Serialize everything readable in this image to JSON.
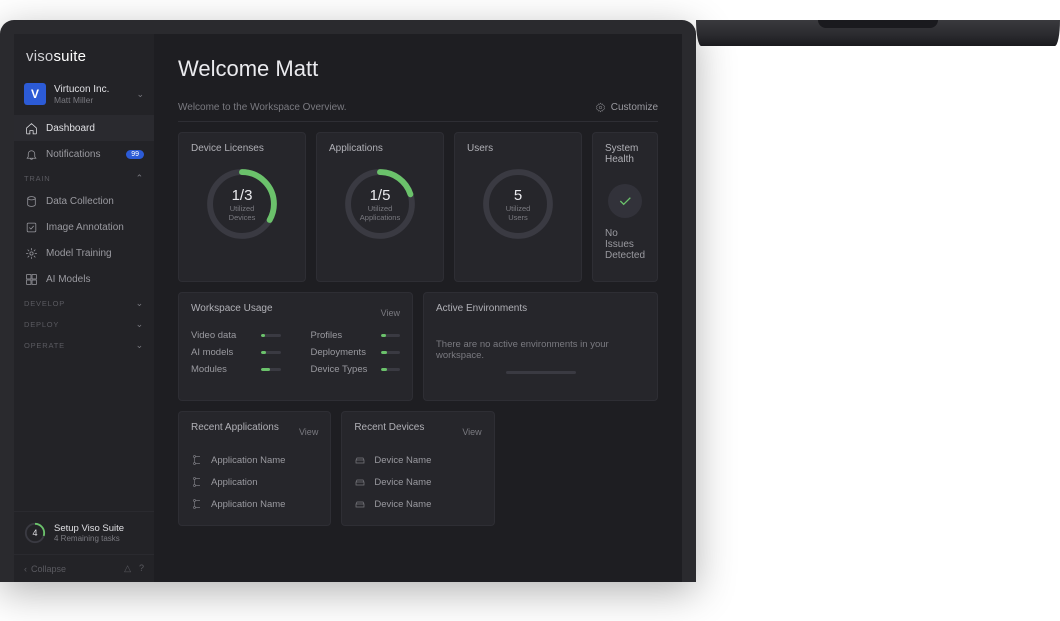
{
  "brand": {
    "prefix": "viso",
    "suffix": "suite"
  },
  "org": {
    "badge": "V",
    "name": "Virtucon Inc.",
    "user": "Matt Miller"
  },
  "nav": {
    "dashboard": "Dashboard",
    "notifications": "Notifications",
    "notifications_badge": "99",
    "train": {
      "label": "TRAIN",
      "items": [
        "Data Collection",
        "Image Annotation",
        "Model Training",
        "AI Models"
      ]
    },
    "develop": "DEVELOP",
    "deploy": "DEPLOY",
    "operate": "OPERATE"
  },
  "setup": {
    "count": "4",
    "title": "Setup Viso Suite",
    "sub": "4 Remaining tasks"
  },
  "collapse": "Collapse",
  "header": {
    "title": "Welcome Matt",
    "subtitle": "Welcome to the Workspace Overview.",
    "customize": "Customize"
  },
  "stats": {
    "licenses": {
      "title": "Device Licenses",
      "value": "1/3",
      "label1": "Utilized",
      "label2": "Devices",
      "pct": 0.333
    },
    "apps": {
      "title": "Applications",
      "value": "1/5",
      "label1": "Utilized",
      "label2": "Applications",
      "pct": 0.2
    },
    "users": {
      "title": "Users",
      "value": "5",
      "label1": "Utilized",
      "label2": "Users",
      "pct": 0.0
    }
  },
  "health": {
    "title": "System Health",
    "status": "No Issues Detected"
  },
  "usage": {
    "title": "Workspace Usage",
    "view": "View",
    "rows": [
      {
        "label": "Video data",
        "pct": 22
      },
      {
        "label": "AI models",
        "pct": 26
      },
      {
        "label": "Modules",
        "pct": 45
      },
      {
        "label": "Profiles",
        "pct": 30
      },
      {
        "label": "Deployments",
        "pct": 32
      },
      {
        "label": "Device Types",
        "pct": 32
      }
    ]
  },
  "environments": {
    "title": "Active Environments",
    "empty": "There are no active environments in your workspace."
  },
  "recent_apps": {
    "title": "Recent Applications",
    "view": "View",
    "items": [
      "Application Name",
      "Application",
      "Application Name"
    ]
  },
  "recent_devices": {
    "title": "Recent Devices",
    "view": "View",
    "items": [
      "Device Name",
      "Device Name",
      "Device Name"
    ]
  },
  "colors": {
    "accent": "#6bc26b",
    "brand_blue": "#2c5bd6"
  }
}
